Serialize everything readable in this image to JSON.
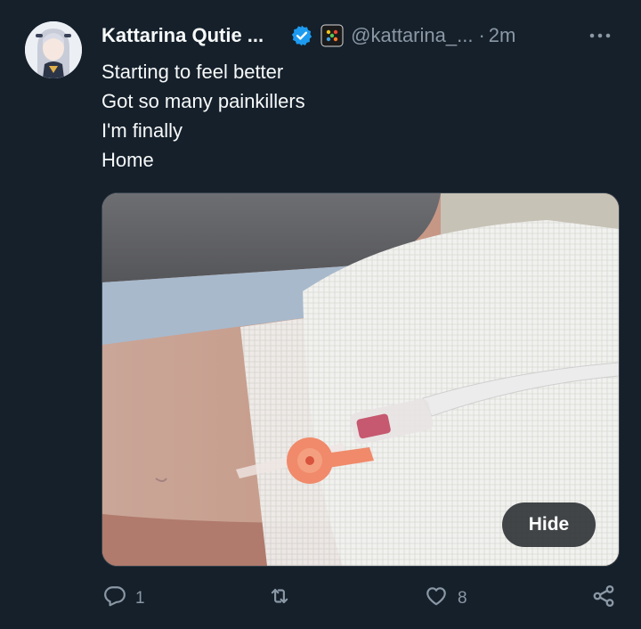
{
  "tweet": {
    "display_name": "Kattarina Qutie ...",
    "handle": "@kattarina_...",
    "separator": "·",
    "time": "2m",
    "lines": [
      "Starting to feel better",
      "Got so many painkillers",
      "I'm finally",
      "Home"
    ],
    "media": {
      "hide_label": "Hide"
    },
    "actions": {
      "replies": "1",
      "likes": "8"
    }
  },
  "colors": {
    "background": "#15202b",
    "text": "#f7f9f9",
    "secondary": "#8b98a5",
    "verified": "#1d9bf0"
  },
  "icons": {
    "verified": "verified-badge-icon",
    "affiliate": "affiliate-badge-icon",
    "more": "more-icon",
    "reply": "reply-icon",
    "retweet": "retweet-icon",
    "like": "like-icon",
    "share": "share-icon"
  }
}
